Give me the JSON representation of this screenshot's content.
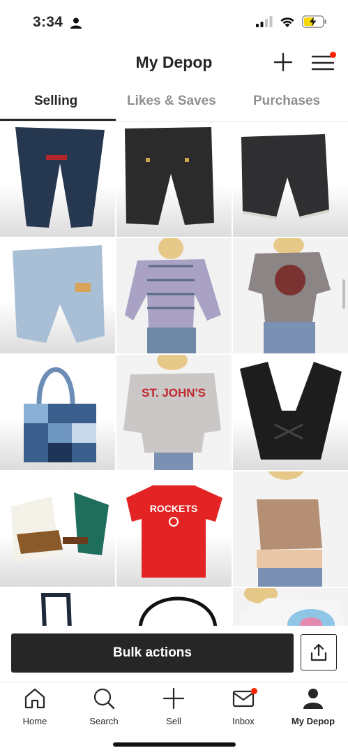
{
  "status_bar": {
    "time": "3:34",
    "icons": [
      "person-icon",
      "signal-icon",
      "wifi-icon",
      "battery-charging-icon"
    ]
  },
  "header": {
    "title": "My Depop",
    "icons": [
      "plus-icon",
      "menu-icon"
    ],
    "menu_has_notification": true
  },
  "tabs": [
    {
      "label": "Selling",
      "active": true
    },
    {
      "label": "Likes & Saves",
      "active": false
    },
    {
      "label": "Purchases",
      "active": false
    }
  ],
  "listings": [
    {
      "item": "bootcut-jeans"
    },
    {
      "item": "black-flare-trousers"
    },
    {
      "item": "black-denim-shorts"
    },
    {
      "item": "light-wash-jeans"
    },
    {
      "item": "striped-blouse"
    },
    {
      "item": "graphic-tee"
    },
    {
      "item": "patchwork-denim-tote"
    },
    {
      "item": "st-johns-sweatshirt",
      "print": "ST. JOHN'S"
    },
    {
      "item": "black-lace-up-pants"
    },
    {
      "item": "boho-outfit-set"
    },
    {
      "item": "rockets-tee",
      "print": "ROCKETS"
    },
    {
      "item": "tan-corset-top"
    },
    {
      "item": "black-tote-bag"
    },
    {
      "item": "black-headband"
    },
    {
      "item": "white-graphic-tee"
    }
  ],
  "bulk_actions": {
    "label": "Bulk actions",
    "share_icon": "share-icon"
  },
  "bottom_nav": [
    {
      "label": "Home",
      "icon": "home-icon",
      "active": false
    },
    {
      "label": "Search",
      "icon": "search-icon",
      "active": false
    },
    {
      "label": "Sell",
      "icon": "plus-icon",
      "active": false
    },
    {
      "label": "Inbox",
      "icon": "mail-icon",
      "active": false,
      "notification": true
    },
    {
      "label": "My Depop",
      "icon": "profile-icon",
      "active": true
    }
  ],
  "colors": {
    "text": "#262626",
    "inactive_tab": "#8f8f8f",
    "notification": "#ff2300",
    "button": "#262626"
  }
}
